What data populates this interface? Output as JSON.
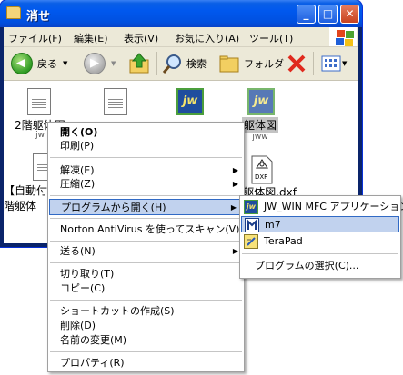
{
  "window": {
    "title": "消せ"
  },
  "menubar": [
    "ファイル(F)",
    "編集(E)",
    "表示(V)",
    "お気に入り(A)",
    "ツール(T)"
  ],
  "toolbar": {
    "back": "戻る",
    "search": "検索",
    "folders": "フォルダ"
  },
  "files": [
    {
      "name": "2階躯体図",
      "ext": "jw"
    },
    {
      "name": "",
      "ext": ""
    },
    {
      "name": "",
      "ext": ""
    },
    {
      "name": "躯体図",
      "ext": "jww"
    },
    {
      "name": "【自動付",
      "ext": ""
    },
    {
      "name": "階躯体",
      "ext": ""
    },
    {
      "name": "躯体図.dxf",
      "ext": "DXF"
    }
  ],
  "context_menu": {
    "items": [
      {
        "label": "開く(O)",
        "bold": true
      },
      {
        "label": "印刷(P)"
      },
      {
        "label": "解凍(E)",
        "submenu": true
      },
      {
        "label": "圧縮(Z)",
        "submenu": true
      },
      {
        "label": "プログラムから開く(H)",
        "submenu": true,
        "highlight": true
      },
      {
        "label": "Norton AntiVirus を使ってスキャン(V)"
      },
      {
        "label": "送る(N)",
        "submenu": true
      },
      {
        "label": "切り取り(T)"
      },
      {
        "label": "コピー(C)"
      },
      {
        "label": "ショートカットの作成(S)"
      },
      {
        "label": "削除(D)"
      },
      {
        "label": "名前の変更(M)"
      },
      {
        "label": "プロパティ(R)"
      }
    ]
  },
  "open_with": {
    "items": [
      {
        "label": "JW_WIN MFC アプリケーション",
        "icon": "jw-icon"
      },
      {
        "label": "m7",
        "icon": "m7-icon",
        "highlight": true
      },
      {
        "label": "TeraPad",
        "icon": "terapad-icon"
      },
      {
        "label": "プログラムの選択(C)..."
      }
    ]
  }
}
